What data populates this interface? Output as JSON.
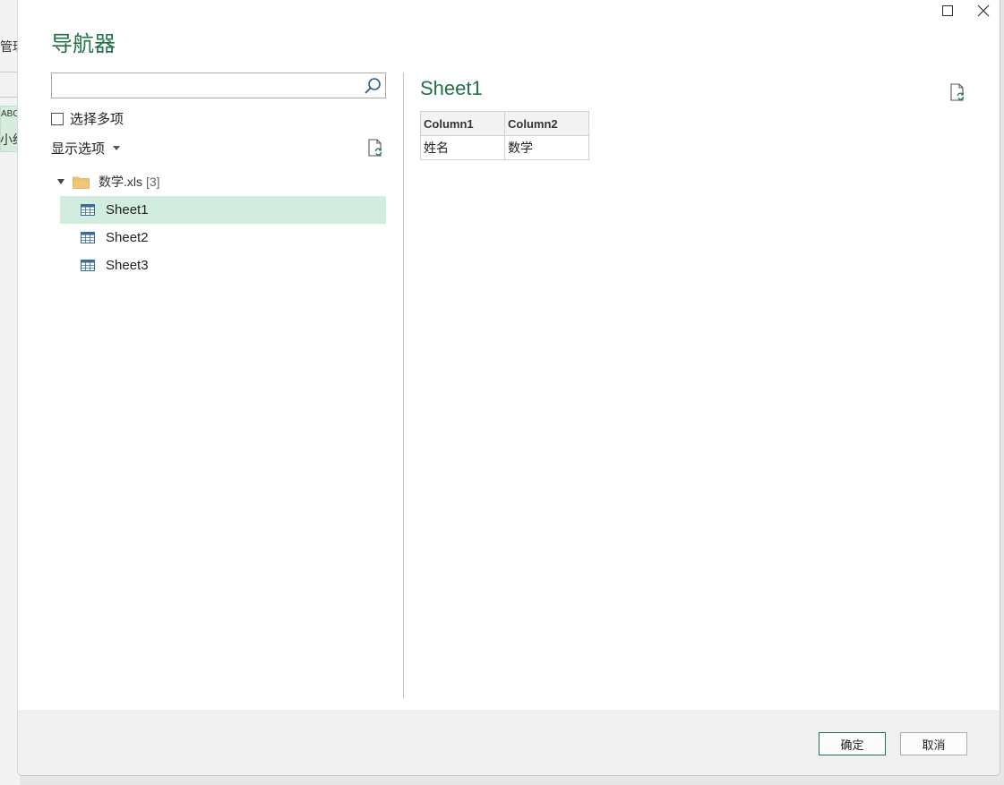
{
  "background": {
    "ribbon_fragment": "管理",
    "cell_type": "ABC",
    "cell_fragment": "小红"
  },
  "dialog": {
    "title": "导航器",
    "search": {
      "value": "",
      "placeholder": ""
    },
    "select_multiple_label": "选择多项",
    "display_options_label": "显示选项",
    "tree": {
      "root_name": "数学.xls",
      "root_count": "[3]",
      "items": [
        {
          "label": "Sheet1",
          "selected": true
        },
        {
          "label": "Sheet2",
          "selected": false
        },
        {
          "label": "Sheet3",
          "selected": false
        }
      ]
    },
    "preview": {
      "title": "Sheet1",
      "columns": [
        "Column1",
        "Column2"
      ],
      "rows": [
        [
          "姓名",
          "数学"
        ]
      ]
    },
    "footer": {
      "ok_label": "确定",
      "cancel_label": "取消"
    }
  },
  "icons": {
    "search": "search-icon",
    "refresh": "refresh-icon",
    "folder": "folder-icon",
    "table": "table-icon",
    "maximize": "maximize-icon",
    "close": "close-icon"
  },
  "colors": {
    "accent": "#217346",
    "selection": "#d2ede0",
    "footer": "#f0f0f0"
  }
}
